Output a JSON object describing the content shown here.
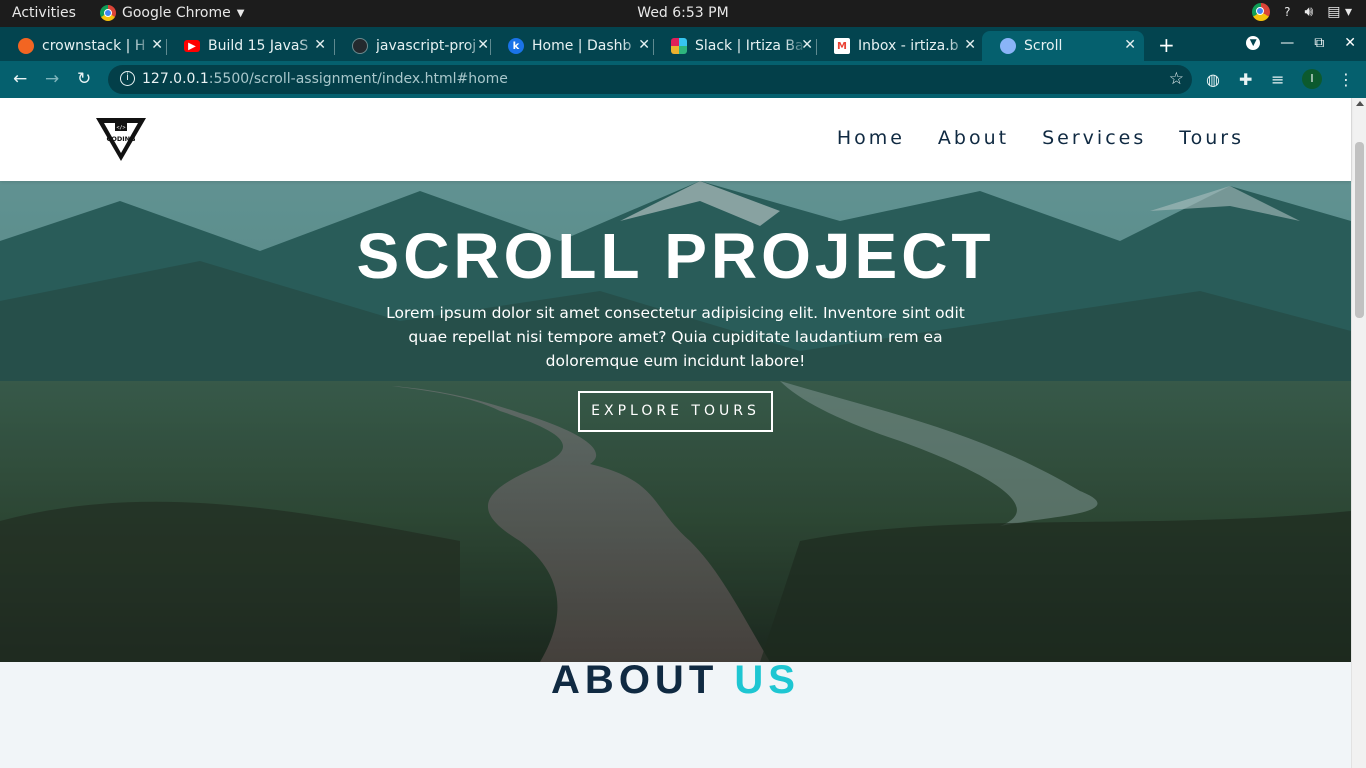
{
  "os_bar": {
    "activities": "Activities",
    "app_name": "Google Chrome",
    "clock": "Wed  6:53 PM",
    "help": "?"
  },
  "tabs": [
    {
      "title": "crownstack | H",
      "favicon": "crownstack-icon",
      "color": "#f26522"
    },
    {
      "title": "Build 15 JavaS",
      "favicon": "youtube-icon",
      "color": "#ff0000"
    },
    {
      "title": "javascript-proj",
      "favicon": "github-icon",
      "color": "#24292e"
    },
    {
      "title": "Home | Dashb",
      "favicon": "k-icon",
      "color": "#1a73e8",
      "letter": "k"
    },
    {
      "title": "Slack | Irtiza Ba",
      "favicon": "slack-icon",
      "color": "#4a154b"
    },
    {
      "title": "Inbox - irtiza.b",
      "favicon": "gmail-icon",
      "color": "#ea4335"
    },
    {
      "title": "Scroll",
      "favicon": "globe-icon",
      "color": "#8ab4f8"
    }
  ],
  "address_bar": {
    "url_host": "127.0.0.1",
    "url_rest": ":5500/scroll-assignment/index.html#home",
    "avatar_letter": "I"
  },
  "site": {
    "logo_text": "CODING",
    "nav": [
      "Home",
      "About",
      "Services",
      "Tours"
    ],
    "hero": {
      "title": "SCROLL PROJECT",
      "text": "Lorem ipsum dolor sit amet consectetur adipisicing elit. Inventore sint odit quae repellat nisi tempore amet? Quia cupiditate laudantium rem ea doloremque eum incidunt labore!",
      "button": "EXPLORE TOURS"
    },
    "about": {
      "title_main": "ABOUT ",
      "title_accent": "US"
    }
  },
  "colors": {
    "nav_text": "#102a42",
    "accent": "#1ec6d2",
    "tab_bar": "#03444f",
    "toolbar": "#05606e"
  }
}
